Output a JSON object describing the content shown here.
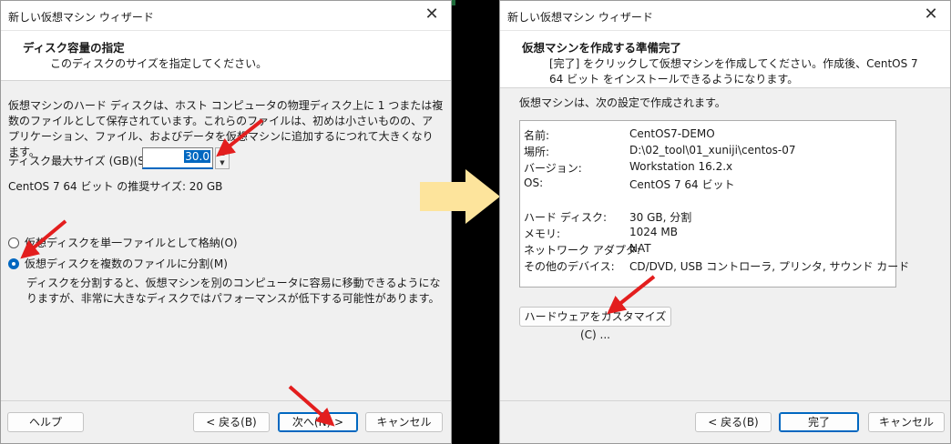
{
  "left_window": {
    "title": "新しい仮想マシン ウィザード",
    "close_glyph": "✕",
    "header_title": "ディスク容量の指定",
    "header_subtitle": "このディスクのサイズを指定してください。",
    "description": "仮想マシンのハード ディスクは、ホスト コンピュータの物理ディスク上に 1 つまたは複数のファイルとして保存されています。これらのファイルは、初めは小さいものの、アプリケーション、ファイル、およびデータを仮想マシンに追加するにつれて大きくなります。",
    "disk_size_label": "ディスク最大サイズ (GB)(S):",
    "disk_size_value": "30.0",
    "recommended": "CentOS 7 64 ビット の推奨サイズ: 20 GB",
    "radio_single": "仮想ディスクを単一ファイルとして格納(O)",
    "radio_split": "仮想ディスクを複数のファイルに分割(M)",
    "split_note": "ディスクを分割すると、仮想マシンを別のコンピュータに容易に移動できるようになりますが、非常に大きなディスクではパフォーマンスが低下する可能性があります。",
    "buttons": {
      "help": "ヘルプ",
      "back": "< 戻る(B)",
      "next": "次へ(N) >",
      "cancel": "キャンセル"
    }
  },
  "right_window": {
    "title": "新しい仮想マシン ウィザード",
    "close_glyph": "✕",
    "header_title": "仮想マシンを作成する準備完了",
    "header_subtitle": "[完了] をクリックして仮想マシンを作成してください。作成後、CentOS 7 64 ビット をインストールできるようになります。",
    "intro": "仮想マシンは、次の設定で作成されます。",
    "summary": [
      {
        "key": "名前:",
        "value": "CentOS7-DEMO"
      },
      {
        "key": "場所:",
        "value": "D:\\02_tool\\01_xuniji\\centos-07"
      },
      {
        "key": "バージョン:",
        "value": "Workstation 16.2.x"
      },
      {
        "key": "OS:",
        "value": "CentOS 7 64 ビット"
      },
      {
        "key": "ハード ディスク:",
        "value": "30 GB, 分割"
      },
      {
        "key": "メモリ:",
        "value": "1024 MB"
      },
      {
        "key": "ネットワーク アダプタ:",
        "value": "NAT"
      },
      {
        "key": "その他のデバイス:",
        "value": "CD/DVD, USB コントローラ, プリンタ, サウンド カード"
      }
    ],
    "customize_button": "ハードウェアをカスタマイズ(C) ...",
    "buttons": {
      "back": "< 戻る(B)",
      "finish": "完了",
      "cancel": "キャンセル"
    }
  },
  "colors": {
    "accent": "#0067c0",
    "annotation_arrow": "#e31e1e",
    "flow_arrow": "#fde49c"
  },
  "icons": {
    "flow_arrow": "right-arrow",
    "annotations": "red-pointer-arrow"
  }
}
